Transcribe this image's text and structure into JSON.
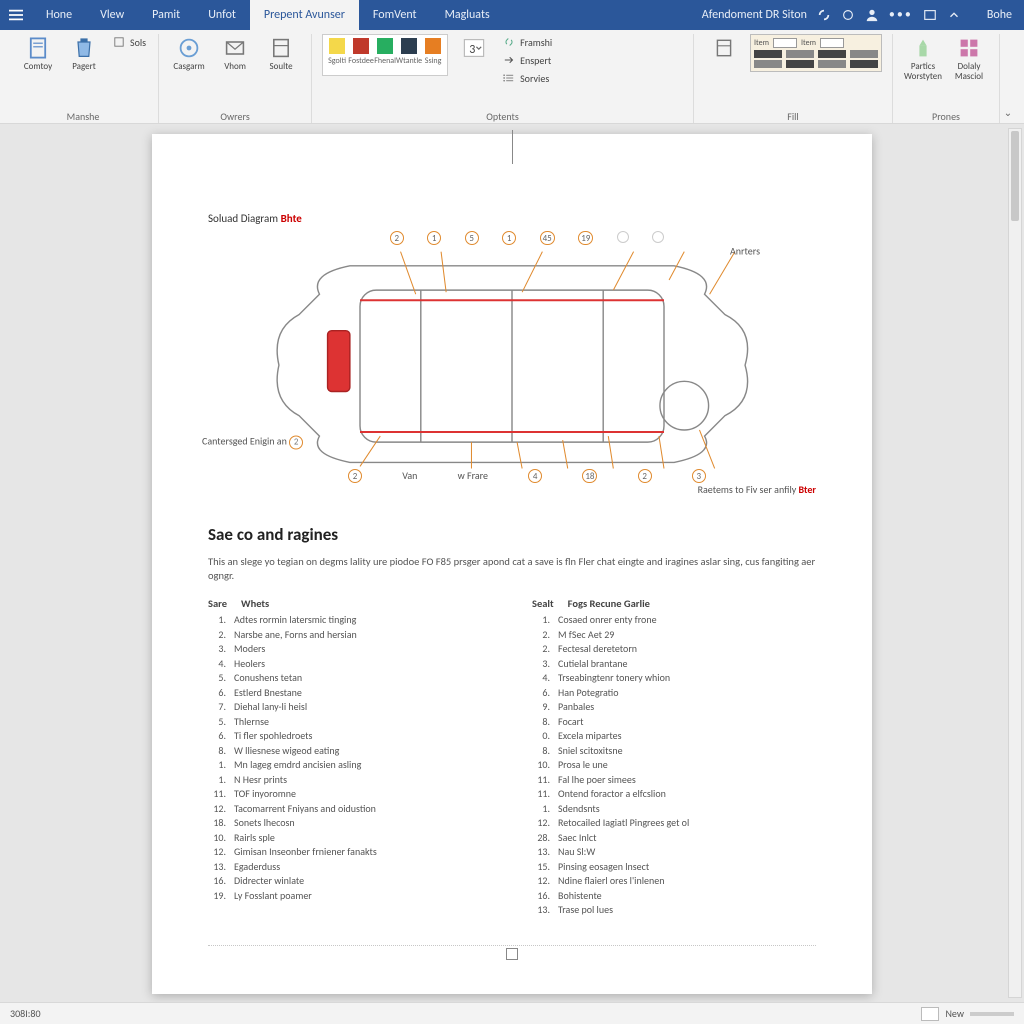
{
  "tabs": {
    "items": [
      "Hone",
      "Vlew",
      "Pamit",
      "Unfot",
      "Prepent Avunser",
      "FomVent",
      "Magluats"
    ],
    "active_index": 4,
    "right_label_1": "Afendoment DR Siton",
    "right_label_2": "Bohe"
  },
  "ribbon": {
    "groups": [
      {
        "label": "Manshe",
        "big": [
          {
            "name": "comtoy-btn",
            "label": "Comtoy",
            "icon": "page"
          },
          {
            "name": "pagert-btn",
            "label": "Pagert",
            "icon": "trash"
          }
        ],
        "small": [
          {
            "label": "Sols",
            "icon": "square"
          }
        ]
      },
      {
        "label": "Owrers",
        "big": [
          {
            "name": "casgarm-btn",
            "label": "Casgarm",
            "icon": "target"
          },
          {
            "name": "vhom-btn",
            "label": "Vhom",
            "icon": "mail"
          },
          {
            "name": "soulte-btn",
            "label": "Soulte",
            "icon": "sheet"
          }
        ]
      },
      {
        "label": "Optents",
        "swatches": [
          {
            "label": "Sgolti",
            "color": "#f4d84a"
          },
          {
            "label": "Fostdee",
            "color": "#c0392b"
          },
          {
            "label": "Fhenal",
            "color": "#27ae60"
          },
          {
            "label": "Wtantle",
            "color": "#2c3e50"
          },
          {
            "label": "Ssing",
            "color": "#e67e22"
          }
        ],
        "drop": {
          "label": "3",
          "icon": "dropdown"
        },
        "small": [
          {
            "label": "Framshi",
            "icon": "link"
          },
          {
            "label": "Enspert",
            "icon": "arrow-r"
          },
          {
            "label": "Sorvies",
            "icon": "list"
          }
        ]
      },
      {
        "label": "Fill",
        "style_head_labels": [
          "Item",
          "Item"
        ]
      },
      {
        "label": "Prones",
        "big": [
          {
            "name": "partics-btn",
            "label": "Partics Worstyten",
            "icon": "person"
          },
          {
            "name": "dolaly-btn",
            "label": "Dolaly Masciol",
            "icon": "grid"
          }
        ]
      }
    ]
  },
  "doc": {
    "diagram_title_a": "Soluad Diagram",
    "diagram_title_b": "Bhte",
    "side_left": "Cantersged Enigin an",
    "side_right": "Anrters",
    "callouts_top": [
      "2",
      "1",
      "5",
      "1",
      "45",
      "19"
    ],
    "callouts_bot": [
      "2",
      "Van",
      "w Frare",
      "4",
      "18",
      "2",
      "3"
    ],
    "footnote_a": "Raetems to Fiv ser anfily",
    "footnote_b": "Bter",
    "section_title": "Sae co and ragines",
    "body": "This an slege yo tegian on degms lality ure piodoe FO F85 prsger apond cat a save is fln Fler chat eingte and iragines aslar sing, cus fangiting aer ogngr.",
    "col1_heads": [
      "Sare",
      "Whets"
    ],
    "col2_heads": [
      "Sealt",
      "Fogs Recune Garlie"
    ],
    "col1": [
      {
        "n": "1",
        "t": "Adtes rormin latersmic tinging"
      },
      {
        "n": "2",
        "t": "Narsbe ane, Forns and hersian"
      },
      {
        "n": "3",
        "t": "Moders"
      },
      {
        "n": "4",
        "t": "Heolers"
      },
      {
        "n": "5",
        "t": "Conushens tetan"
      },
      {
        "n": "6",
        "t": "Estlerd Bnestane"
      },
      {
        "n": "7",
        "t": "Diehal lany-li heisl"
      },
      {
        "n": "5",
        "t": "Thlernse"
      },
      {
        "n": "6",
        "t": "Ti fler spohledroets"
      },
      {
        "n": "8",
        "t": "W lliesnese wigeod eating"
      },
      {
        "n": "1",
        "t": "Mn lageg emdrd ancisien asling"
      },
      {
        "n": "1",
        "t": "N Hesr prints"
      },
      {
        "n": "11",
        "t": "TOF inyoromne"
      },
      {
        "n": "12",
        "t": "Tacomarrent Fniyans and oidustion"
      },
      {
        "n": "18",
        "t": "Sonets lhecosn"
      },
      {
        "n": "10",
        "t": "Rairls sple"
      },
      {
        "n": "12",
        "t": "Gimisan Inseonber frniener fanakts"
      },
      {
        "n": "13",
        "t": "Egaderduss"
      },
      {
        "n": "16",
        "t": "Didrecter winlate"
      },
      {
        "n": "19",
        "t": "Ly Fosslant poamer"
      }
    ],
    "col2": [
      {
        "n": "1",
        "t": "Cosaed onrer enty frone"
      },
      {
        "n": "2",
        "t": "M fSec Aet 29"
      },
      {
        "n": "2",
        "t": "Fectesal deretetorn"
      },
      {
        "n": "3",
        "t": "Cutielal brantane"
      },
      {
        "n": "4",
        "t": "Trseabingtenr tonery whion"
      },
      {
        "n": "6",
        "t": "Han Potegratio"
      },
      {
        "n": "9",
        "t": "Panbales"
      },
      {
        "n": "8",
        "t": "Focart"
      },
      {
        "n": "0",
        "t": "Excela mipartes"
      },
      {
        "n": "8",
        "t": "Sniel scitoxitsne"
      },
      {
        "n": "10",
        "t": "Prosa le une"
      },
      {
        "n": "11",
        "t": "Fal lhe poer simees"
      },
      {
        "n": "11",
        "t": "Ontend foractor a elfcslion"
      },
      {
        "n": "1",
        "t": "Sdendsnts"
      },
      {
        "n": "12",
        "t": "Retocailed Iagiatl Pingrees get ol"
      },
      {
        "n": "28",
        "t": "Saec Inlct"
      },
      {
        "n": "13",
        "t": "Nau Sl:W"
      },
      {
        "n": "15",
        "t": "Pinsing eosagen lnsect"
      },
      {
        "n": "12",
        "t": "Ndine flaierl ores l'inlenen"
      },
      {
        "n": "16",
        "t": "Bohistente"
      },
      {
        "n": "13",
        "t": "Trase pol lues"
      }
    ]
  },
  "status": {
    "left": "308I:80",
    "right": "New"
  }
}
